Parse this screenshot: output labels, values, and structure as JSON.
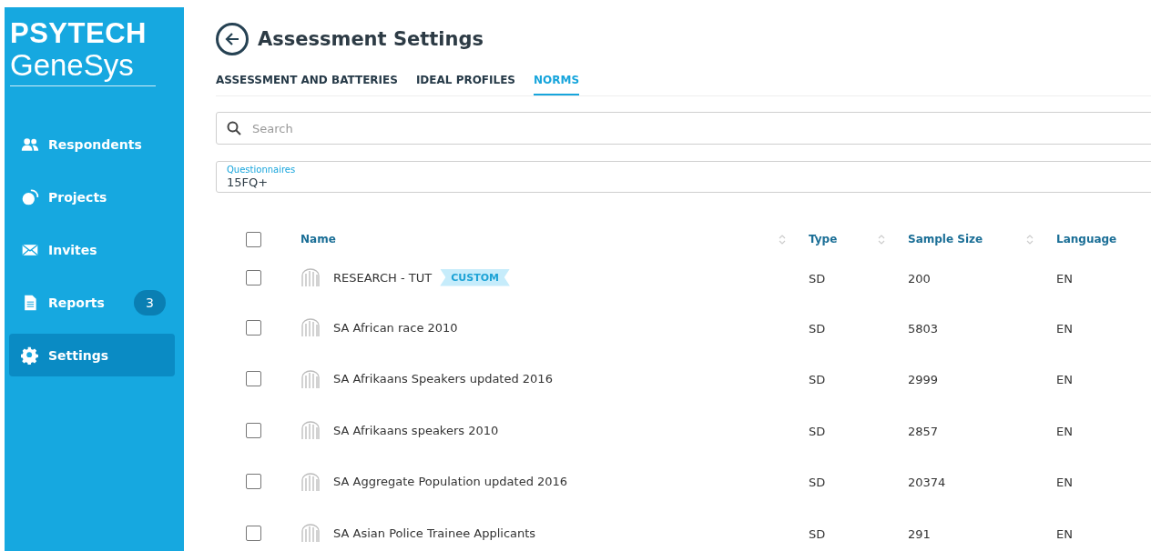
{
  "logo": {
    "line_1": "PSYTECH",
    "line_2": "GeneSys"
  },
  "sidebar": {
    "items": [
      {
        "kind": "people",
        "label": "Respondents",
        "selected": false
      },
      {
        "kind": "projects",
        "label": "Projects",
        "selected": false
      },
      {
        "kind": "mail",
        "label": "Invites",
        "selected": false
      },
      {
        "kind": "document",
        "label": "Reports",
        "badge": "3",
        "selected": false
      },
      {
        "kind": "gear",
        "label": "Settings",
        "selected": true
      }
    ]
  },
  "page": {
    "title": "Assessment Settings"
  },
  "tabs": [
    {
      "label": "ASSESSMENT AND BATTERIES",
      "selected": false
    },
    {
      "label": "IDEAL PROFILES",
      "selected": false
    },
    {
      "label": "NORMS",
      "selected": true
    }
  ],
  "search": {
    "placeholder": "Search"
  },
  "questionnaires": {
    "label": "Questionnaires",
    "value": "15FQ+"
  },
  "table": {
    "select_all_checked": false,
    "columns": [
      {
        "label": "Name",
        "sortable": true
      },
      {
        "label": "Type",
        "sortable": true
      },
      {
        "label": "Sample Size",
        "sortable": true
      },
      {
        "label": "Language",
        "sortable": false
      }
    ],
    "rows": [
      {
        "checked": false,
        "name": "RESEARCH - TUT",
        "tag": "CUSTOM",
        "type": "SD",
        "sample_size": "200",
        "language": "EN"
      },
      {
        "checked": false,
        "name": "SA African race 2010",
        "type": "SD",
        "sample_size": "5803",
        "language": "EN"
      },
      {
        "checked": false,
        "name": "SA Afrikaans Speakers updated 2016",
        "type": "SD",
        "sample_size": "2999",
        "language": "EN"
      },
      {
        "checked": false,
        "name": "SA Afrikaans speakers 2010",
        "type": "SD",
        "sample_size": "2857",
        "language": "EN"
      },
      {
        "checked": false,
        "name": "SA Aggregate Population updated 2016",
        "type": "SD",
        "sample_size": "20374",
        "language": "EN"
      },
      {
        "checked": false,
        "name": "SA Asian Police Trainee Applicants",
        "type": "SD",
        "sample_size": "291",
        "language": "EN"
      }
    ]
  }
}
